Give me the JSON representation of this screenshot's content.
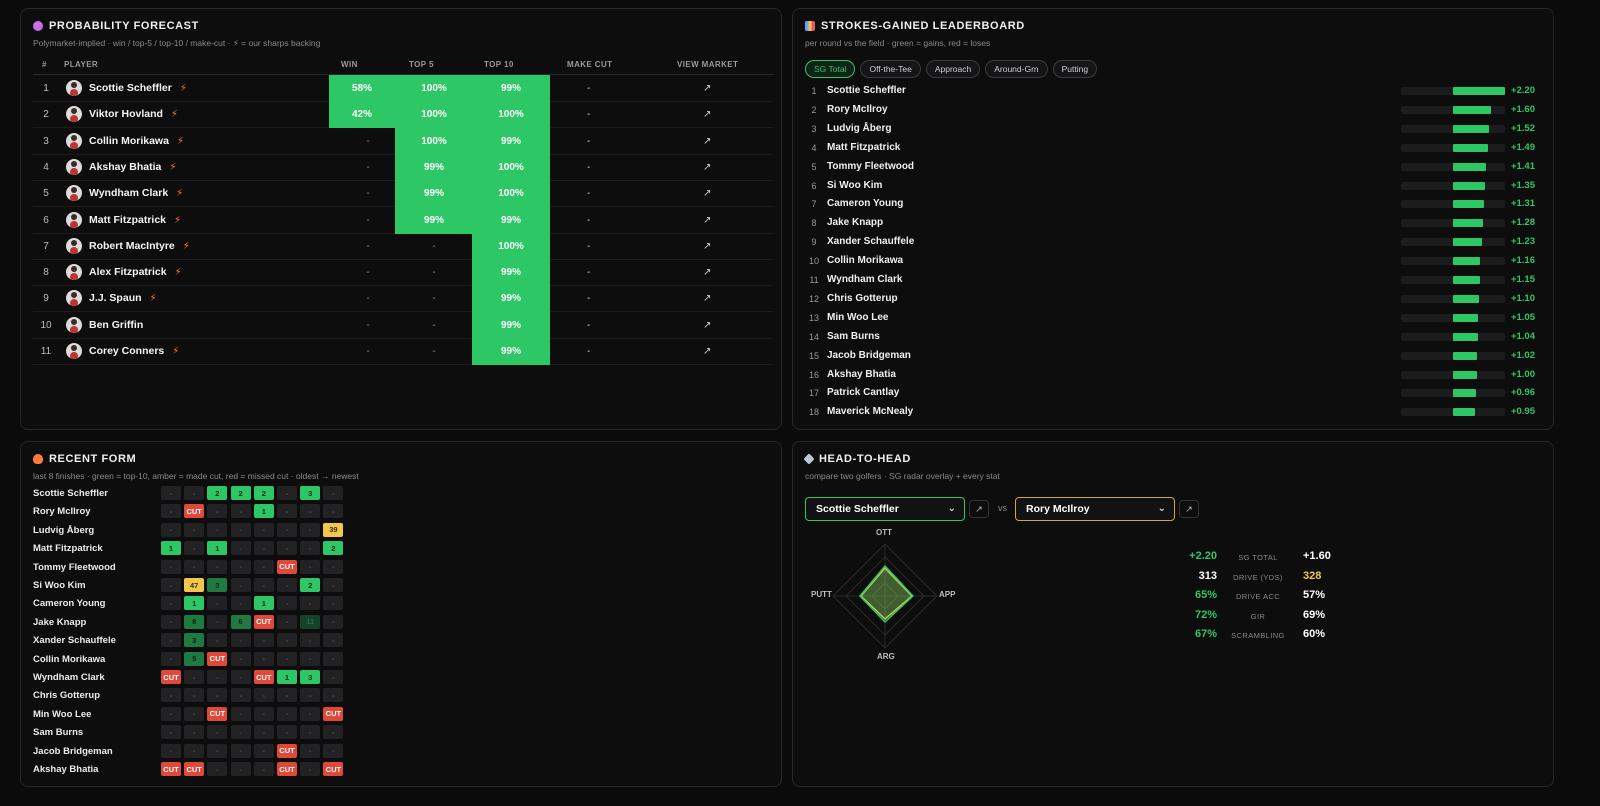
{
  "forecast": {
    "title": "PROBABILITY FORECAST",
    "subtitle": "Polymarket-implied · win / top-5 / top-10 / make-cut · ⚡ = our sharps backing",
    "headers": {
      "rank": "#",
      "player": "PLAYER",
      "win": "WIN",
      "top5": "TOP 5",
      "top10": "TOP 10",
      "make_cut": "MAKE CUT",
      "view": "VIEW MARKET"
    },
    "rows": [
      {
        "rank": "1",
        "name": "Scottie Scheffler",
        "win": "58%",
        "top5": "100%",
        "top10": "99%",
        "make_cut": "-",
        "view": "↗"
      },
      {
        "rank": "2",
        "name": "Viktor Hovland",
        "win": "42%",
        "top5": "100%",
        "top10": "100%",
        "make_cut": "-",
        "view": "↗"
      },
      {
        "rank": "3",
        "name": "Collin Morikawa",
        "win": "-",
        "top5": "100%",
        "top10": "99%",
        "make_cut": "-",
        "view": "↗"
      },
      {
        "rank": "4",
        "name": "Akshay Bhatia",
        "win": "-",
        "top5": "99%",
        "top10": "100%",
        "make_cut": "-",
        "view": "↗"
      },
      {
        "rank": "5",
        "name": "Wyndham Clark",
        "win": "-",
        "top5": "99%",
        "top10": "100%",
        "make_cut": "-",
        "view": "↗"
      },
      {
        "rank": "6",
        "name": "Matt Fitzpatrick",
        "win": "-",
        "top5": "99%",
        "top10": "99%",
        "make_cut": "-",
        "view": "↗"
      },
      {
        "rank": "7",
        "name": "Robert MacIntyre",
        "win": "-",
        "top5": "-",
        "top10": "100%",
        "make_cut": "-",
        "view": "↗"
      },
      {
        "rank": "8",
        "name": "Alex Fitzpatrick",
        "win": "-",
        "top5": "-",
        "top10": "99%",
        "make_cut": "-",
        "view": "↗"
      },
      {
        "rank": "9",
        "name": "J.J. Spaun",
        "win": "-",
        "top5": "-",
        "top10": "99%",
        "make_cut": "-",
        "view": "↗"
      },
      {
        "rank": "10",
        "name": "Ben Griffin",
        "win": "-",
        "top5": "-",
        "top10": "99%",
        "make_cut": "-",
        "view": "↗"
      },
      {
        "rank": "11",
        "name": "Corey Conners",
        "win": "-",
        "top5": "-",
        "top10": "99%",
        "make_cut": "-",
        "view": "↗"
      }
    ],
    "bolt_rows": [
      0,
      1,
      2,
      3,
      4,
      5,
      6,
      7,
      8,
      10
    ]
  },
  "sg": {
    "title": "STROKES-GAINED LEADERBOARD",
    "subtitle": "per round vs the field · green = gains, red = loses",
    "tabs": [
      "SG Total",
      "Off-the-Tee",
      "Approach",
      "Around-Grn",
      "Putting"
    ],
    "active_tab": "SG Total",
    "rows": [
      {
        "rank": "1",
        "name": "Scottie Scheffler",
        "value": "+2.20",
        "v": 2.2
      },
      {
        "rank": "2",
        "name": "Rory McIlroy",
        "value": "+1.60",
        "v": 1.6
      },
      {
        "rank": "3",
        "name": "Ludvig Åberg",
        "value": "+1.52",
        "v": 1.52
      },
      {
        "rank": "4",
        "name": "Matt Fitzpatrick",
        "value": "+1.49",
        "v": 1.49
      },
      {
        "rank": "5",
        "name": "Tommy Fleetwood",
        "value": "+1.41",
        "v": 1.41
      },
      {
        "rank": "6",
        "name": "Si Woo Kim",
        "value": "+1.35",
        "v": 1.35
      },
      {
        "rank": "7",
        "name": "Cameron Young",
        "value": "+1.31",
        "v": 1.31
      },
      {
        "rank": "8",
        "name": "Jake Knapp",
        "value": "+1.28",
        "v": 1.28
      },
      {
        "rank": "9",
        "name": "Xander Schauffele",
        "value": "+1.23",
        "v": 1.23
      },
      {
        "rank": "10",
        "name": "Collin Morikawa",
        "value": "+1.16",
        "v": 1.16
      },
      {
        "rank": "11",
        "name": "Wyndham Clark",
        "value": "+1.15",
        "v": 1.15
      },
      {
        "rank": "12",
        "name": "Chris Gotterup",
        "value": "+1.10",
        "v": 1.1
      },
      {
        "rank": "13",
        "name": "Min Woo Lee",
        "value": "+1.05",
        "v": 1.05
      },
      {
        "rank": "14",
        "name": "Sam Burns",
        "value": "+1.04",
        "v": 1.04
      },
      {
        "rank": "15",
        "name": "Jacob Bridgeman",
        "value": "+1.02",
        "v": 1.02
      },
      {
        "rank": "16",
        "name": "Akshay Bhatia",
        "value": "+1.00",
        "v": 1.0
      },
      {
        "rank": "17",
        "name": "Patrick Cantlay",
        "value": "+0.96",
        "v": 0.96
      },
      {
        "rank": "18",
        "name": "Maverick McNealy",
        "value": "+0.95",
        "v": 0.95
      }
    ]
  },
  "form": {
    "title": "RECENT FORM",
    "subtitle": "last 8 finishes · green = top-10, amber = made cut, red = missed cut · oldest → newest",
    "rows": [
      {
        "name": "Scottie Scheffler",
        "cells": [
          [
            "-",
            "e"
          ],
          [
            "-",
            "e"
          ],
          [
            "2",
            "green"
          ],
          [
            "2",
            "green"
          ],
          [
            "2",
            "green"
          ],
          [
            "-",
            "e"
          ],
          [
            "3",
            "green"
          ],
          [
            "-",
            "e"
          ]
        ]
      },
      {
        "name": "Rory McIlroy",
        "cells": [
          [
            "-",
            "e"
          ],
          [
            "CUT",
            "red"
          ],
          [
            "-",
            "e"
          ],
          [
            "-",
            "e"
          ],
          [
            "1",
            "green"
          ],
          [
            "-",
            "e"
          ],
          [
            "-",
            "e"
          ],
          [
            "-",
            "e"
          ]
        ]
      },
      {
        "name": "Ludvig Åberg",
        "cells": [
          [
            "-",
            "e"
          ],
          [
            "-",
            "e"
          ],
          [
            "-",
            "e"
          ],
          [
            "-",
            "e"
          ],
          [
            "-",
            "e"
          ],
          [
            "-",
            "e"
          ],
          [
            "-",
            "e"
          ],
          [
            "39",
            "amber"
          ]
        ]
      },
      {
        "name": "Matt Fitzpatrick",
        "cells": [
          [
            "1",
            "green"
          ],
          [
            "-",
            "e"
          ],
          [
            "1",
            "green"
          ],
          [
            "-",
            "e"
          ],
          [
            "-",
            "e"
          ],
          [
            "-",
            "e"
          ],
          [
            "-",
            "e"
          ],
          [
            "2",
            "green"
          ]
        ]
      },
      {
        "name": "Tommy Fleetwood",
        "cells": [
          [
            "-",
            "e"
          ],
          [
            "-",
            "e"
          ],
          [
            "-",
            "e"
          ],
          [
            "-",
            "e"
          ],
          [
            "-",
            "e"
          ],
          [
            "CUT",
            "red"
          ],
          [
            "-",
            "e"
          ],
          [
            "-",
            "e"
          ]
        ]
      },
      {
        "name": "Si Woo Kim",
        "cells": [
          [
            "-",
            "e"
          ],
          [
            "47",
            "amber"
          ],
          [
            "3",
            "dgreen"
          ],
          [
            "-",
            "e"
          ],
          [
            "-",
            "e"
          ],
          [
            "-",
            "e"
          ],
          [
            "2",
            "green"
          ],
          [
            "-",
            "e"
          ]
        ]
      },
      {
        "name": "Cameron Young",
        "cells": [
          [
            "-",
            "e"
          ],
          [
            "1",
            "green"
          ],
          [
            "-",
            "e"
          ],
          [
            "-",
            "e"
          ],
          [
            "1",
            "green"
          ],
          [
            "-",
            "e"
          ],
          [
            "-",
            "e"
          ],
          [
            "-",
            "e"
          ]
        ]
      },
      {
        "name": "Jake Knapp",
        "cells": [
          [
            "-",
            "e"
          ],
          [
            "8",
            "dgreen"
          ],
          [
            "-",
            "e"
          ],
          [
            "6",
            "dgreen"
          ],
          [
            "CUT",
            "red"
          ],
          [
            "-",
            "e"
          ],
          [
            "11",
            "ddgreen"
          ],
          [
            "-",
            "e"
          ]
        ]
      },
      {
        "name": "Xander Schauffele",
        "cells": [
          [
            "-",
            "e"
          ],
          [
            "3",
            "dgreen"
          ],
          [
            "-",
            "e"
          ],
          [
            "-",
            "e"
          ],
          [
            "-",
            "e"
          ],
          [
            "-",
            "e"
          ],
          [
            "-",
            "e"
          ],
          [
            "-",
            "e"
          ]
        ]
      },
      {
        "name": "Collin Morikawa",
        "cells": [
          [
            "-",
            "e"
          ],
          [
            "5",
            "dgreen"
          ],
          [
            "CUT",
            "red"
          ],
          [
            "-",
            "e"
          ],
          [
            "-",
            "e"
          ],
          [
            "-",
            "e"
          ],
          [
            "-",
            "e"
          ],
          [
            "-",
            "e"
          ]
        ]
      },
      {
        "name": "Wyndham Clark",
        "cells": [
          [
            "CUT",
            "red"
          ],
          [
            "-",
            "e"
          ],
          [
            "-",
            "e"
          ],
          [
            "-",
            "e"
          ],
          [
            "CUT",
            "red"
          ],
          [
            "1",
            "green"
          ],
          [
            "3",
            "green"
          ],
          [
            "-",
            "e"
          ]
        ]
      },
      {
        "name": "Chris Gotterup",
        "cells": [
          [
            "-",
            "e"
          ],
          [
            "-",
            "e"
          ],
          [
            "-",
            "e"
          ],
          [
            "-",
            "e"
          ],
          [
            "-",
            "e"
          ],
          [
            "-",
            "e"
          ],
          [
            "-",
            "e"
          ],
          [
            "-",
            "e"
          ]
        ]
      },
      {
        "name": "Min Woo Lee",
        "cells": [
          [
            "-",
            "e"
          ],
          [
            "-",
            "e"
          ],
          [
            "CUT",
            "red"
          ],
          [
            "-",
            "e"
          ],
          [
            "-",
            "e"
          ],
          [
            "-",
            "e"
          ],
          [
            "-",
            "e"
          ],
          [
            "CUT",
            "red"
          ]
        ]
      },
      {
        "name": "Sam Burns",
        "cells": [
          [
            "-",
            "e"
          ],
          [
            "-",
            "e"
          ],
          [
            "-",
            "e"
          ],
          [
            "-",
            "e"
          ],
          [
            "-",
            "e"
          ],
          [
            "-",
            "e"
          ],
          [
            "-",
            "e"
          ],
          [
            "-",
            "e"
          ]
        ]
      },
      {
        "name": "Jacob Bridgeman",
        "cells": [
          [
            "-",
            "e"
          ],
          [
            "-",
            "e"
          ],
          [
            "-",
            "e"
          ],
          [
            "-",
            "e"
          ],
          [
            "-",
            "e"
          ],
          [
            "CUT",
            "red"
          ],
          [
            "-",
            "e"
          ],
          [
            "-",
            "e"
          ]
        ]
      },
      {
        "name": "Akshay Bhatia",
        "cells": [
          [
            "CUT",
            "red"
          ],
          [
            "CUT",
            "red"
          ],
          [
            "-",
            "e"
          ],
          [
            "-",
            "e"
          ],
          [
            "-",
            "e"
          ],
          [
            "CUT",
            "red"
          ],
          [
            "-",
            "e"
          ],
          [
            "CUT",
            "red"
          ]
        ]
      }
    ]
  },
  "h2h": {
    "title": "HEAD-TO-HEAD",
    "subtitle": "compare two golfers · SG radar overlay + every stat",
    "player_a": "Scottie Scheffler",
    "player_b": "Rory McIlroy",
    "vs": "vs",
    "link_icon": "↗",
    "radar_labels": {
      "top": "OTT",
      "right": "APP",
      "bottom": "ARG",
      "left": "PUTT"
    },
    "stats": [
      {
        "label": "SG TOTAL",
        "a": "+2.20",
        "b": "+1.60",
        "a_color": "#2ec766",
        "b_color": "#ffffff"
      },
      {
        "label": "DRIVE (YDS)",
        "a": "313",
        "b": "328",
        "a_color": "#ffffff",
        "b_color": "#f1c84d"
      },
      {
        "label": "DRIVE ACC",
        "a": "65%",
        "b": "57%",
        "a_color": "#2ec766",
        "b_color": "#ffffff"
      },
      {
        "label": "GIR",
        "a": "72%",
        "b": "69%",
        "a_color": "#2ec766",
        "b_color": "#ffffff"
      },
      {
        "label": "SCRAMBLING",
        "a": "67%",
        "b": "60%",
        "a_color": "#2ec766",
        "b_color": "#ffffff"
      }
    ]
  },
  "colors": {
    "accent_green": "#2ec766",
    "amber": "#f1c84d",
    "red": "#e0483a",
    "bolt": "#ff7a3c"
  }
}
